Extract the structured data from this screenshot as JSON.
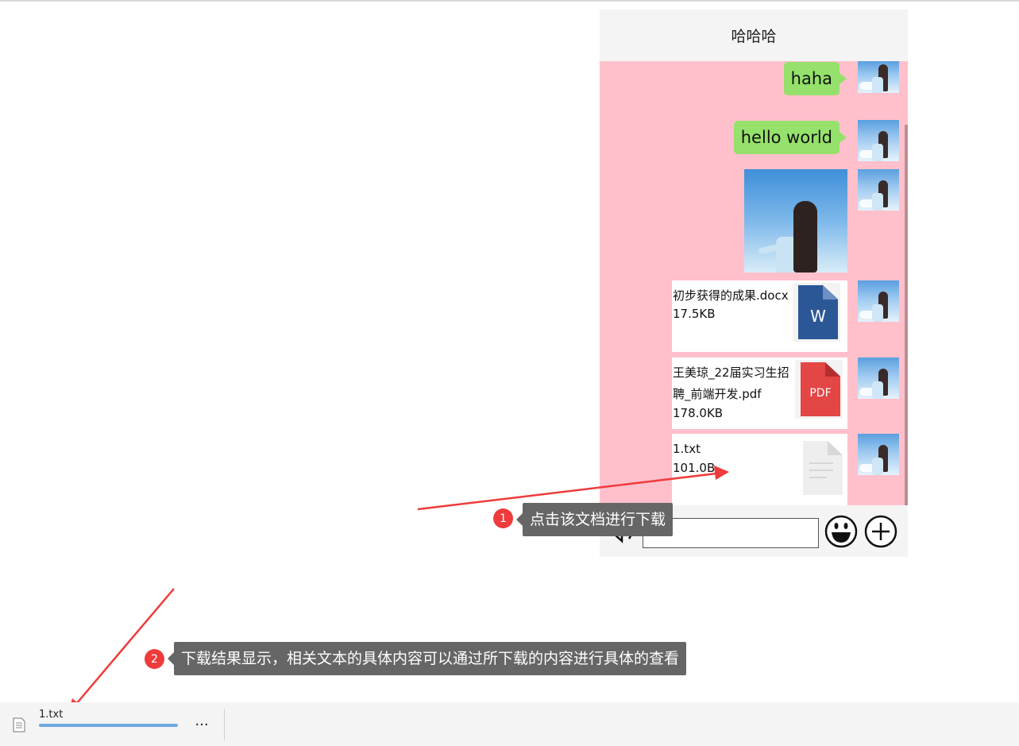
{
  "chat": {
    "title": "哈哈哈",
    "messages": [
      {
        "type": "text",
        "text": "haha"
      },
      {
        "type": "text",
        "text": "hello world"
      },
      {
        "type": "image"
      },
      {
        "type": "file",
        "name": "初步获得的成果.docx",
        "size": "17.5KB",
        "icon": "word-doc-icon",
        "icon_letter": "W",
        "icon_color": "#2b5797"
      },
      {
        "type": "file",
        "name": "王美琼_22届实习生招聘_前端开发.pdf",
        "size": "178.0KB",
        "icon": "pdf-doc-icon",
        "icon_letter": "PDF",
        "icon_color": "#e44545"
      },
      {
        "type": "file",
        "name": "1.txt",
        "size": "101.0B",
        "icon": "txt-doc-icon"
      }
    ],
    "input": {
      "value": "",
      "placeholder": ""
    },
    "toolbar_icons": [
      "voice-icon",
      "emoji-icon",
      "plus-icon"
    ]
  },
  "annotations": [
    {
      "step": "1",
      "text": "点击该文档进行下载"
    },
    {
      "step": "2",
      "text": "下载结果显示，相关文本的具体内容可以通过所下载的内容进行具体的查看"
    }
  ],
  "download_bar": {
    "file_name": "1.txt",
    "progress": 1.0,
    "more_label": "...",
    "icon": "text-file-icon"
  },
  "colors": {
    "chat_background": "#ffc0cb",
    "bubble": "#95e16b",
    "annotation": "#ef3b3b",
    "tooltip": "#666666",
    "progress": "#6fa9de"
  }
}
